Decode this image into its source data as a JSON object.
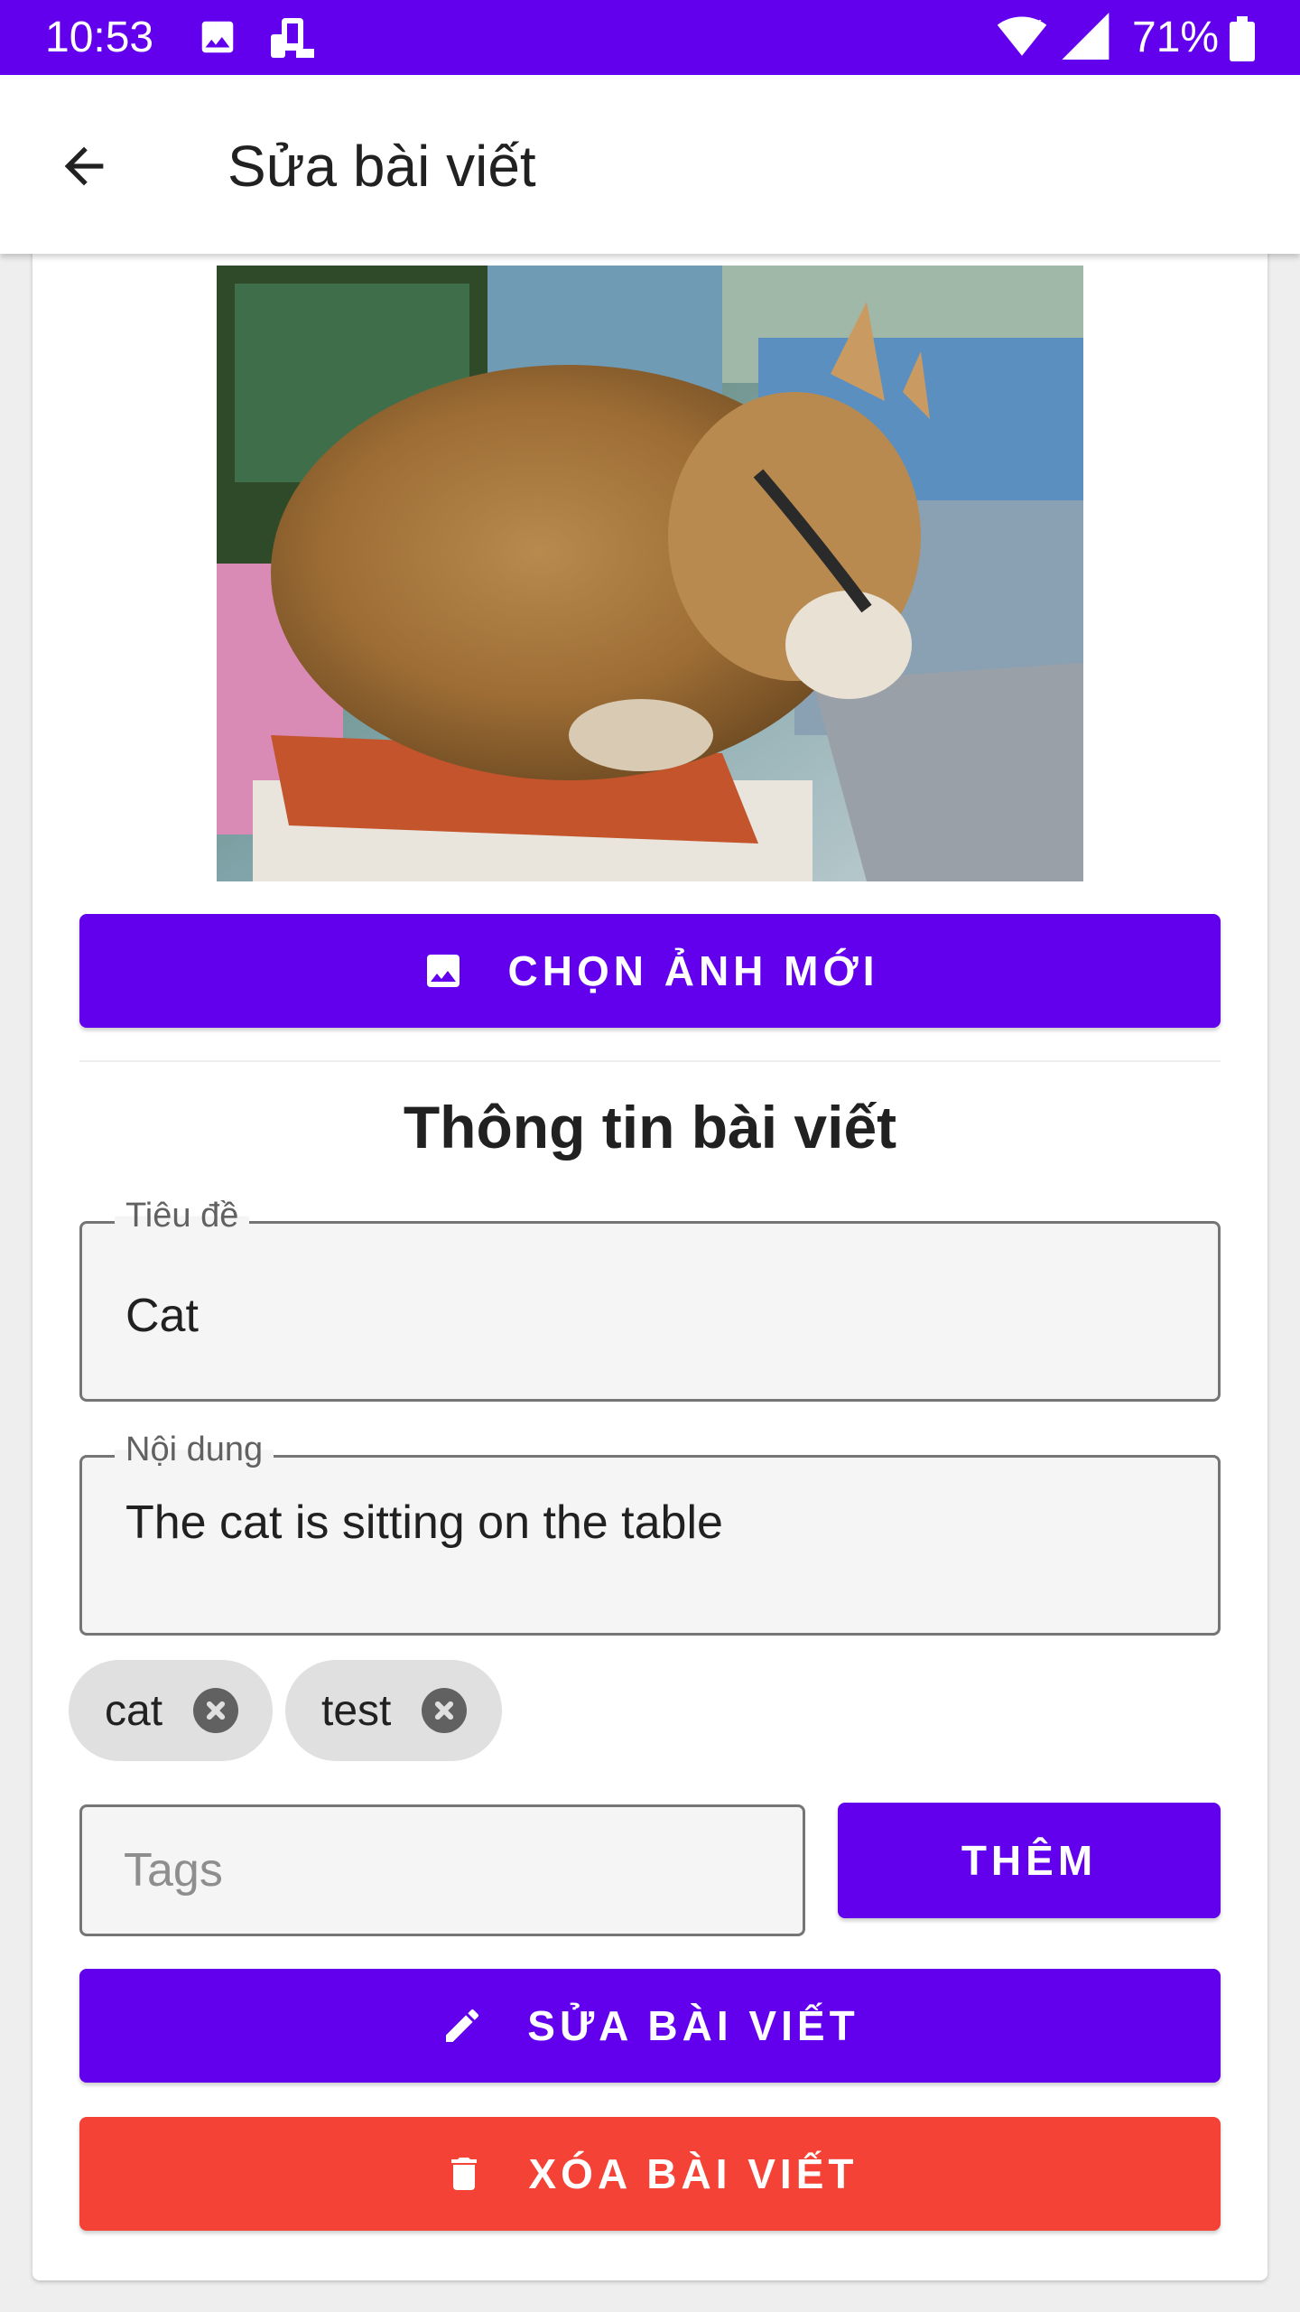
{
  "status_bar": {
    "time": "10:53",
    "battery": "71%",
    "icons": [
      "gallery-icon",
      "screen-mirror-icon",
      "wifi-icon",
      "signal-icon",
      "battery-icon"
    ]
  },
  "app_bar": {
    "title": "Sửa bài viết",
    "back_icon": "arrow-back-icon"
  },
  "image": {
    "subject": "cat-photo"
  },
  "buttons": {
    "choose_image": "CHỌN ẢNH MỚI",
    "add_tag": "THÊM",
    "edit_post": "SỬA BÀI VIẾT",
    "delete_post": "XÓA BÀI VIẾT"
  },
  "section_title": "Thông tin bài viết",
  "form": {
    "title_label": "Tiêu đề",
    "title_value": "Cat",
    "content_label": "Nội dung",
    "content_value": "The cat is sitting on the table",
    "tags_placeholder": "Tags"
  },
  "tags": [
    "cat",
    "test"
  ],
  "colors": {
    "primary": "#6200ee",
    "danger": "#f44336",
    "chip": "#e0e0e0"
  }
}
